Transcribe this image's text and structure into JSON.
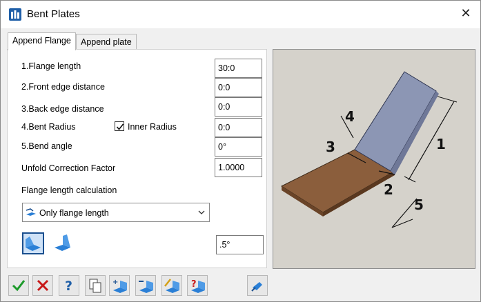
{
  "window": {
    "title": "Bent Plates"
  },
  "tabs": [
    {
      "label": "Append Flange",
      "active": true
    },
    {
      "label": "Append plate",
      "active": false
    }
  ],
  "form": {
    "flange_length": {
      "label": "1.Flange length",
      "value": "30:0"
    },
    "front_edge": {
      "label": "2.Front edge distance",
      "value": "0:0"
    },
    "back_edge": {
      "label": "3.Back edge distance",
      "value": "0:0"
    },
    "bent_radius": {
      "label": "4.Bent Radius",
      "value": "0:0"
    },
    "inner_radius": {
      "label": "Inner Radius",
      "checked": true
    },
    "bend_angle": {
      "label": "5.Bend angle",
      "value": "0°"
    },
    "unfold": {
      "label": "Unfold Correction Factor",
      "value": "1.0000"
    },
    "calc_label": "Flange length calculation",
    "calc_selected": "Only flange length",
    "step_value": ".5°"
  },
  "preview": {
    "labels": [
      "1",
      "2",
      "3",
      "4",
      "5"
    ],
    "colors": {
      "flange": "#8c96b4",
      "plate": "#8b5e3c",
      "background": "#d5d2cb"
    }
  },
  "toolbar": {
    "icons": [
      "ok-check-icon",
      "cancel-x-icon",
      "help-icon",
      "copy-page-icon",
      "add-flange-icon",
      "remove-flange-icon",
      "edit-flange-icon",
      "flange-info-icon",
      "pick-icon"
    ]
  }
}
